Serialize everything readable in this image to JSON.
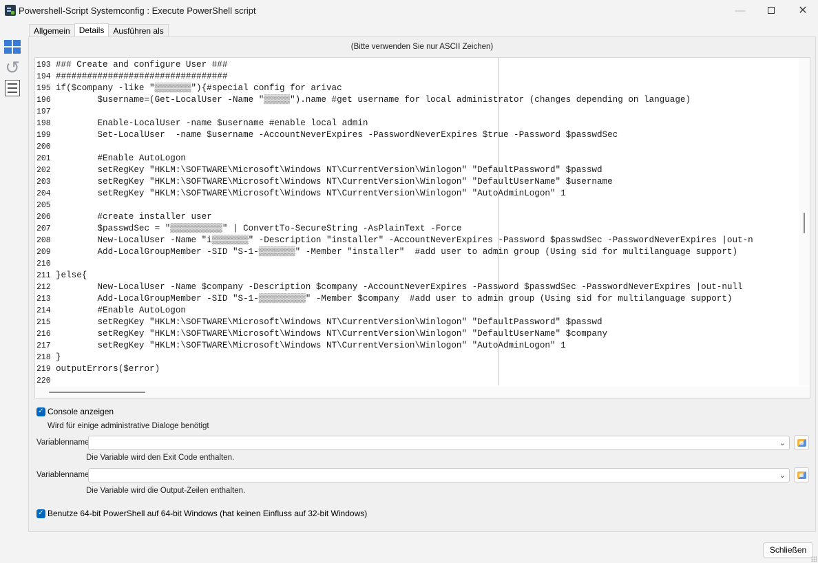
{
  "window": {
    "title": "Powershell-Script Systemconfig : Execute PowerShell script",
    "icon": "powershell-app-icon"
  },
  "tabs": [
    {
      "label": "Allgemein",
      "active": false
    },
    {
      "label": "Details",
      "active": true
    },
    {
      "label": "Ausführen als",
      "active": false
    }
  ],
  "hint": "(Bitte verwenden Sie nur ASCII Zeichen)",
  "code_lines": [
    {
      "n": "193",
      "text": "### Create and configure User ###"
    },
    {
      "n": "194",
      "text": "#################################"
    },
    {
      "n": "195",
      "text": "if($company -like \"▒▒▒▒▒▒▒\"){#special config for arivac"
    },
    {
      "n": "196",
      "text": "        $username=(Get-LocalUser -Name \"▒▒▒▒▒\").name #get username for local administrator (changes depending on language)"
    },
    {
      "n": "197",
      "text": ""
    },
    {
      "n": "198",
      "text": "        Enable-LocalUser -name $username #enable local admin"
    },
    {
      "n": "199",
      "text": "        Set-LocalUser  -name $username -AccountNeverExpires -PasswordNeverExpires $true -Password $passwdSec"
    },
    {
      "n": "200",
      "text": ""
    },
    {
      "n": "201",
      "text": "        #Enable AutoLogon"
    },
    {
      "n": "202",
      "text": "        setRegKey \"HKLM:\\SOFTWARE\\Microsoft\\Windows NT\\CurrentVersion\\Winlogon\" \"DefaultPassword\" $passwd"
    },
    {
      "n": "203",
      "text": "        setRegKey \"HKLM:\\SOFTWARE\\Microsoft\\Windows NT\\CurrentVersion\\Winlogon\" \"DefaultUserName\" $username"
    },
    {
      "n": "204",
      "text": "        setRegKey \"HKLM:\\SOFTWARE\\Microsoft\\Windows NT\\CurrentVersion\\Winlogon\" \"AutoAdminLogon\" 1"
    },
    {
      "n": "205",
      "text": ""
    },
    {
      "n": "206",
      "text": "        #create installer user"
    },
    {
      "n": "207",
      "text": "        $passwdSec = \"▒▒▒▒▒▒▒▒▒▒\" | ConvertTo-SecureString -AsPlainText -Force"
    },
    {
      "n": "208",
      "text": "        New-LocalUser -Name \"i▒▒▒▒▒▒▒\" -Description \"installer\" -AccountNeverExpires -Password $passwdSec -PasswordNeverExpires |out-n"
    },
    {
      "n": "209",
      "text": "        Add-LocalGroupMember -SID \"S-1-▒▒▒▒▒▒▒\" -Member \"installer\"  #add user to admin group (Using sid for multilanguage support)"
    },
    {
      "n": "210",
      "text": ""
    },
    {
      "n": "211",
      "text": "}else{"
    },
    {
      "n": "212",
      "text": "        New-LocalUser -Name $company -Description $company -AccountNeverExpires -Password $passwdSec -PasswordNeverExpires |out-null"
    },
    {
      "n": "213",
      "text": "        Add-LocalGroupMember -SID \"S-1-▒▒▒▒▒▒▒▒▒\" -Member $company  #add user to admin group (Using sid for multilanguage support)"
    },
    {
      "n": "214",
      "text": "        #Enable AutoLogon"
    },
    {
      "n": "215",
      "text": "        setRegKey \"HKLM:\\SOFTWARE\\Microsoft\\Windows NT\\CurrentVersion\\Winlogon\" \"DefaultPassword\" $passwd"
    },
    {
      "n": "216",
      "text": "        setRegKey \"HKLM:\\SOFTWARE\\Microsoft\\Windows NT\\CurrentVersion\\Winlogon\" \"DefaultUserName\" $company"
    },
    {
      "n": "217",
      "text": "        setRegKey \"HKLM:\\SOFTWARE\\Microsoft\\Windows NT\\CurrentVersion\\Winlogon\" \"AutoAdminLogon\" 1"
    },
    {
      "n": "218",
      "text": "}"
    },
    {
      "n": "219",
      "text": "outputErrors($error)"
    },
    {
      "n": "220",
      "text": ""
    }
  ],
  "console": {
    "checked": true,
    "label": "Console anzeigen",
    "description": "Wird für einige administrative Dialoge benötigt"
  },
  "exit_code_var": {
    "label": "Variablenname",
    "value": "",
    "description": "Die Variable wird den Exit Code enthalten."
  },
  "output_var": {
    "label": "Variablenname",
    "value": "",
    "description": "Die Variable wird die Output-Zeilen enthalten."
  },
  "use64": {
    "checked": true,
    "label": "Benutze 64-bit PowerShell auf 64-bit Windows (hat keinen Einfluss auf 32-bit Windows)"
  },
  "close_label": "Schließen",
  "colors": {
    "accent": "#0067c0",
    "number_literal": "#1a3fd6",
    "keyword": "#000000"
  }
}
